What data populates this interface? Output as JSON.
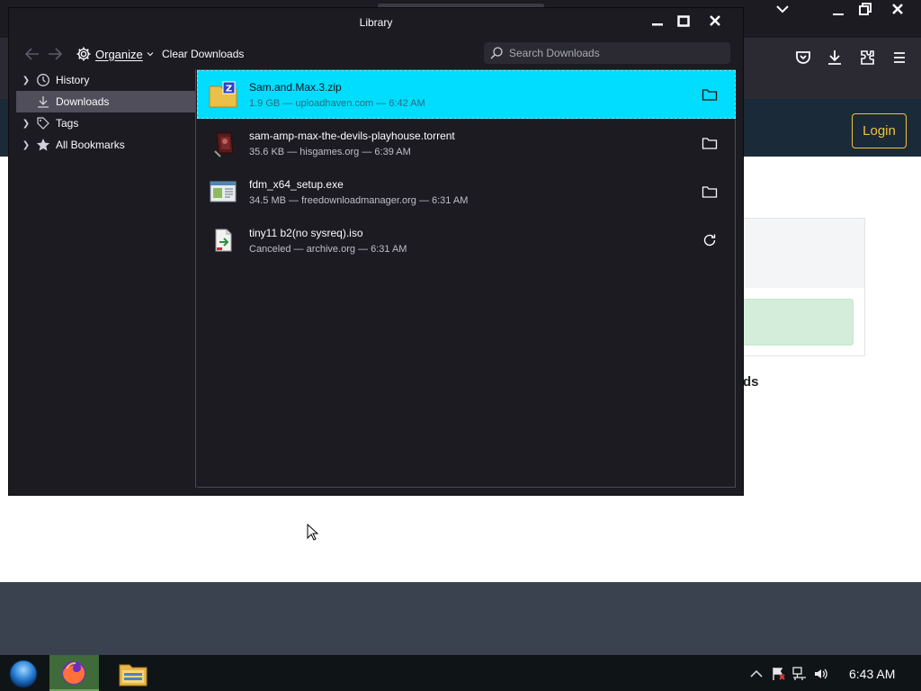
{
  "window": {
    "title": "Library",
    "minimize_label": "minimize",
    "maximize_label": "maximize",
    "close_label": "close"
  },
  "toolbar": {
    "organize_label": "Organize",
    "clear_downloads_label": "Clear Downloads",
    "search_placeholder": "Search Downloads"
  },
  "sidebar": {
    "items": [
      {
        "label": "History",
        "icon": "clock-icon",
        "expandable": true,
        "selected": false
      },
      {
        "label": "Downloads",
        "icon": "download-icon",
        "expandable": false,
        "selected": true
      },
      {
        "label": "Tags",
        "icon": "tag-icon",
        "expandable": true,
        "selected": false
      },
      {
        "label": "All Bookmarks",
        "icon": "star-icon",
        "expandable": true,
        "selected": false
      }
    ]
  },
  "downloads": [
    {
      "name": "Sam.and.Max.3.zip",
      "status": "1.9 GB — uploadhaven.com — 6:42 AM",
      "icon": "zip-archive-icon",
      "action": "open-folder-icon",
      "selected": true
    },
    {
      "name": "sam-amp-max-the-devils-playhouse.torrent",
      "status": "35.6 KB — hisgames.org — 6:39 AM",
      "icon": "torrent-file-icon",
      "action": "open-folder-icon",
      "selected": false
    },
    {
      "name": "fdm_x64_setup.exe",
      "status": "34.5 MB — freedownloadmanager.org — 6:31 AM",
      "icon": "executable-icon",
      "action": "open-folder-icon",
      "selected": false
    },
    {
      "name": "tiny11 b2(no sysreq).iso",
      "status": "Canceled — archive.org — 6:31 AM",
      "icon": "disc-image-icon",
      "action": "retry-icon",
      "selected": false
    }
  ],
  "background_page": {
    "login_label": "Login",
    "partial_heading": "ds"
  },
  "taskbar": {
    "clock": "6:43 AM"
  },
  "colors": {
    "window_bg": "#1c1b22",
    "selected_row": "#00ddff",
    "sidebar_selected": "#4f4e5a",
    "accent_login": "#f0c23a"
  }
}
